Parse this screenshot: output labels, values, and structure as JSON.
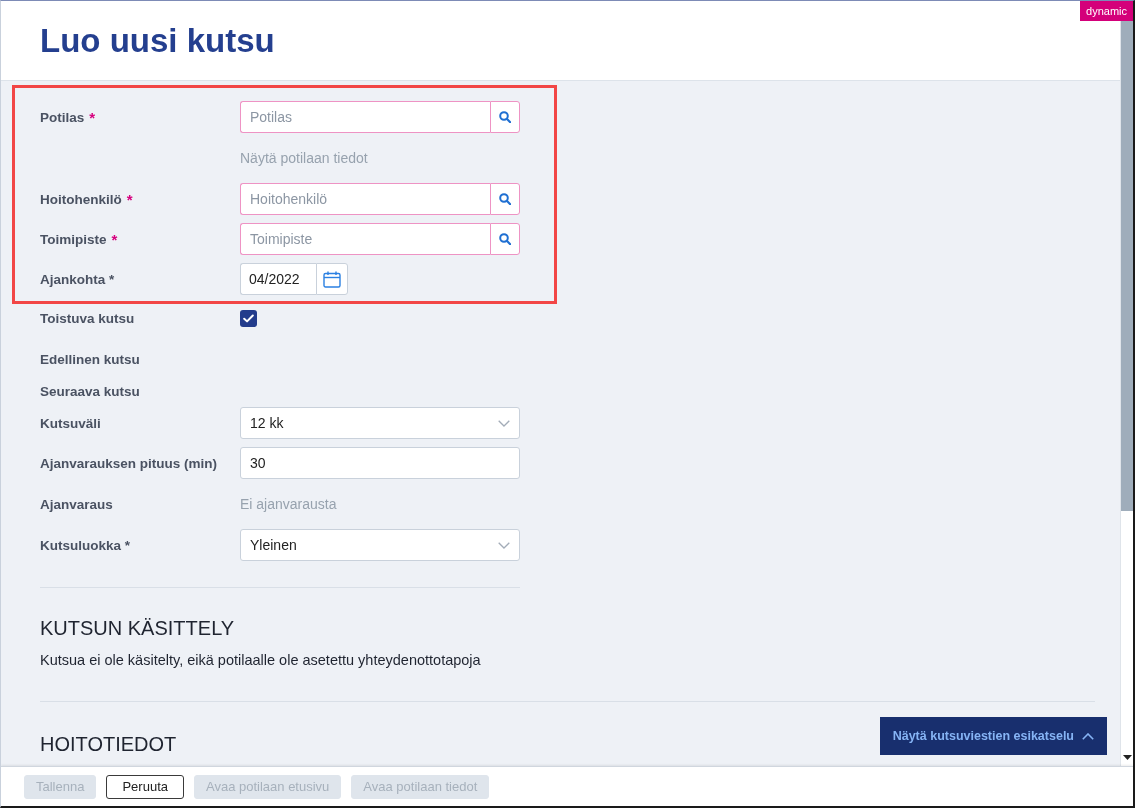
{
  "header": {
    "title": "Luo uusi kutsu",
    "badge": "dynamic"
  },
  "form": {
    "fields": [
      {
        "kind": "lookup",
        "label": "Potilas",
        "required_mark": "*",
        "placeholder": "Potilas",
        "invalid": true,
        "highlighted": true
      },
      {
        "kind": "link",
        "value": "Näytä potilaan tiedot",
        "disabled": true,
        "highlighted": true
      },
      {
        "kind": "lookup",
        "label": "Hoitohenkilö",
        "required_mark": "*",
        "placeholder": "Hoitohenkilö",
        "invalid": true,
        "highlighted": true
      },
      {
        "kind": "lookup",
        "label": "Toimipiste",
        "required_mark": "*",
        "placeholder": "Toimipiste",
        "invalid": true,
        "highlighted": true
      },
      {
        "kind": "date",
        "label": "Ajankohta *",
        "value": "04/2022",
        "highlighted": true
      },
      {
        "kind": "checkbox",
        "label": "Toistuva kutsu",
        "checked": true,
        "highlighted": false
      },
      {
        "kind": "empty",
        "label": "Edellinen kutsu",
        "highlighted": false
      },
      {
        "kind": "empty",
        "label": "Seuraava kutsu",
        "highlighted": false
      },
      {
        "kind": "select",
        "label": "Kutsuväli",
        "value": "12 kk",
        "highlighted": false
      },
      {
        "kind": "input",
        "label": "Ajanvarauksen pituus (min)",
        "value": "30",
        "highlighted": false
      },
      {
        "kind": "text",
        "label": "Ajanvaraus",
        "value": "Ei ajanvarausta",
        "highlighted": false
      },
      {
        "kind": "select",
        "label": "Kutsuluokka *",
        "value": "Yleinen",
        "highlighted": false
      }
    ]
  },
  "sections": [
    {
      "title": "KUTSUN KÄSITTELY",
      "text": "Kutsua ei ole käsitelty, eikä potilaalle ole asetettu yhteydenottotapoja"
    },
    {
      "title": "HOITOTIEDOT"
    }
  ],
  "preview_button": {
    "label": "Näytä kutsuviestien esikatselu"
  },
  "footer": {
    "buttons": [
      {
        "label": "Tallenna",
        "disabled": true
      },
      {
        "label": "Peruuta",
        "disabled": false
      },
      {
        "label": "Avaa potilaan etusivu",
        "disabled": true
      },
      {
        "label": "Avaa potilaan tiedot",
        "disabled": true
      }
    ]
  }
}
